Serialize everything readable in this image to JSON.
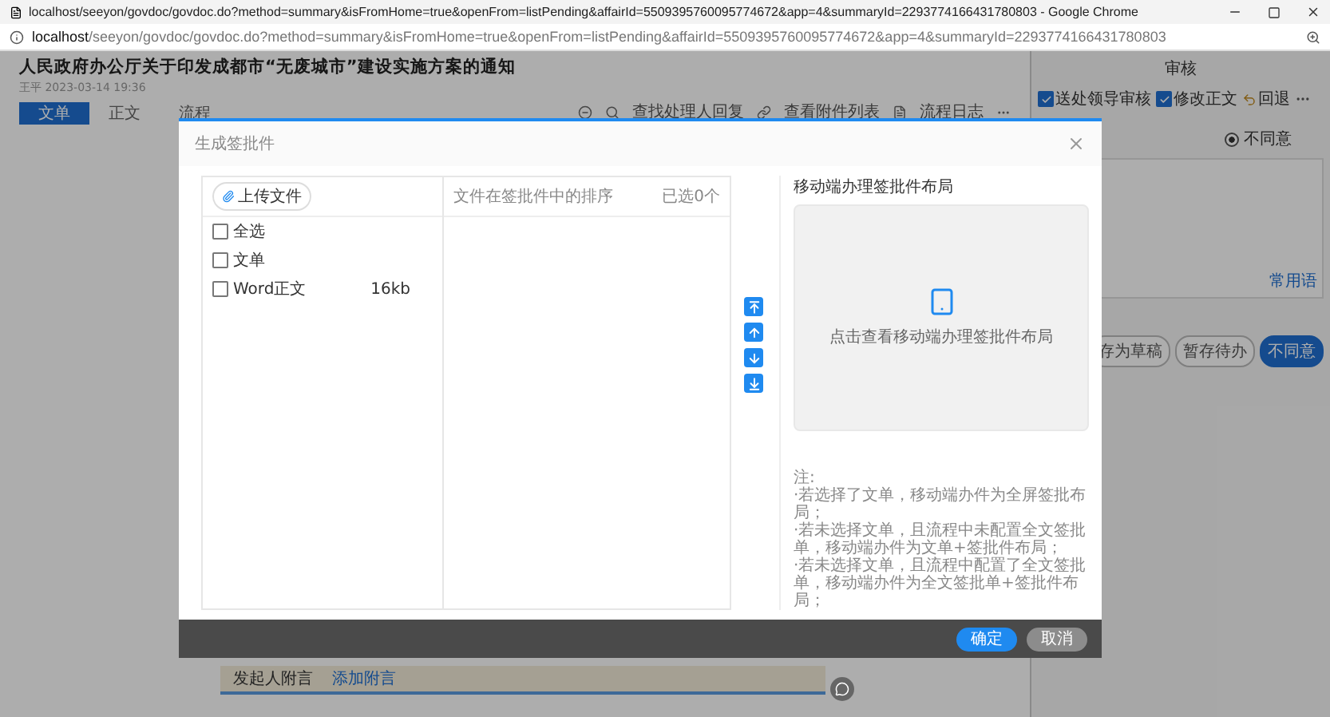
{
  "browser": {
    "title": "localhost/seeyon/govdoc/govdoc.do?method=summary&isFromHome=true&openFrom=listPending&affairId=5509395760095774672&app=4&summaryId=2293774166431780803 - Google Chrome",
    "url_host": "localhost",
    "url_rest": "/seeyon/govdoc/govdoc.do?method=summary&isFromHome=true&openFrom=listPending&affairId=5509395760095774672&app=4&summaryId=2293774166431780803"
  },
  "document": {
    "title": "人民政府办公厅关于印发成都市“无废城市”建设实施方案的通知",
    "meta": "王平 2023-03-14 19:36",
    "tabs": [
      {
        "label": "文单",
        "selected": true
      },
      {
        "label": "正文",
        "selected": false
      },
      {
        "label": "流程",
        "selected": false
      }
    ],
    "toolbar": [
      "查找处理人回复",
      "查看附件列表",
      "流程日志"
    ],
    "sender_note": {
      "label": "发起人附言",
      "link": "添加附言"
    }
  },
  "review_panel": {
    "title": "审核",
    "actions": [
      {
        "kind": "checkbox",
        "label": "送处领导审核",
        "checked": true
      },
      {
        "kind": "checkbox",
        "label": "修改正文",
        "checked": true
      },
      {
        "kind": "button",
        "label": "回退"
      }
    ],
    "options": [
      {
        "label": "不同意",
        "selected": true
      }
    ],
    "phrases_link": "常用语",
    "buttons": [
      {
        "label": "存为草稿",
        "primary": false
      },
      {
        "label": "暂存待办",
        "primary": false
      },
      {
        "label": "不同意",
        "primary": true
      }
    ]
  },
  "dialog": {
    "title": "生成签批件",
    "upload_button": "上传文件",
    "files": [
      {
        "label": "全选",
        "checked": false
      },
      {
        "label": "文单",
        "checked": false
      },
      {
        "label": "Word正文",
        "size": "16kb",
        "checked": false
      }
    ],
    "order_header": "文件在签批件中的排序",
    "selected_count": "已选0个",
    "preview": {
      "title": "移动端办理签批件布局",
      "hint": "点击查看移动端办理签批件布局"
    },
    "notes": [
      "注:",
      "·若选择了文单，移动端办件为全屏签批布局；",
      "·若未选择文单，且流程中未配置全文签批单，移动端办件为文单+签批件布局；",
      "·若未选择文单，且流程中配置了全文签批单，移动端办件为全文签批单+签批件布局；"
    ],
    "buttons": [
      {
        "label": "确定",
        "primary": true
      },
      {
        "label": "取消",
        "primary": false
      }
    ]
  }
}
